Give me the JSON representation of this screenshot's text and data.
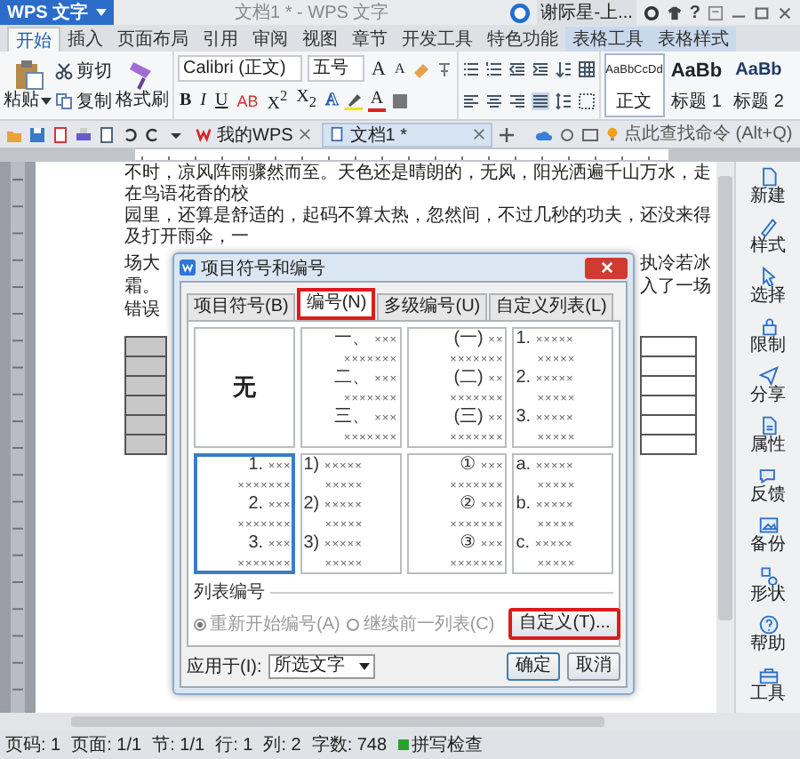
{
  "app_button": {
    "label": "WPS 文字"
  },
  "window": {
    "title": "文档1 * - WPS 文字",
    "user": "谢际星-上...",
    "help": "?"
  },
  "ribbon_tabs": [
    {
      "label": "开始",
      "selected": true,
      "kind": "main"
    },
    {
      "label": "插入",
      "selected": false,
      "kind": "main"
    },
    {
      "label": "页面布局",
      "selected": false,
      "kind": "main"
    },
    {
      "label": "引用",
      "selected": false,
      "kind": "main"
    },
    {
      "label": "审阅",
      "selected": false,
      "kind": "main"
    },
    {
      "label": "视图",
      "selected": false,
      "kind": "main"
    },
    {
      "label": "章节",
      "selected": false,
      "kind": "main"
    },
    {
      "label": "开发工具",
      "selected": false,
      "kind": "main"
    },
    {
      "label": "特色功能",
      "selected": false,
      "kind": "main"
    },
    {
      "label": "表格工具",
      "selected": false,
      "kind": "context"
    },
    {
      "label": "表格样式",
      "selected": false,
      "kind": "context"
    }
  ],
  "clipboard": {
    "paste": "粘贴",
    "cut": "剪切",
    "copy": "复制",
    "format_painter": "格式刷"
  },
  "font": {
    "family": "Calibri (正文)",
    "size": "五号",
    "grow": "A",
    "shrink": "A",
    "format_buttons": [
      {
        "label": "B",
        "kind": "bold"
      },
      {
        "label": "I",
        "kind": "italic"
      },
      {
        "label": "U",
        "kind": "underline"
      },
      {
        "label": "AB",
        "kind": "strike"
      },
      {
        "label": "X$^{2}$",
        "kind": "plain"
      },
      {
        "label": "X$_{2}$",
        "kind": "plain"
      },
      {
        "label": "A",
        "kind": "effect"
      },
      {
        "label": "A",
        "kind": "color"
      }
    ]
  },
  "styles": [
    {
      "sample": "AaBbCcDd",
      "name": "正文",
      "selected": true,
      "kind": "body"
    },
    {
      "sample": "AaBb",
      "name": "标题 1",
      "selected": false,
      "kind": "heading1"
    },
    {
      "sample": "AaBb",
      "name": "标题 2",
      "selected": false,
      "kind": "heading2"
    }
  ],
  "doc_tabs": [
    {
      "label": "我的WPS",
      "selected": false,
      "kind": "home"
    },
    {
      "label": "文档1 *",
      "selected": true,
      "kind": "doc"
    }
  ],
  "command_search": {
    "placeholder": "点此查找命令 (Alt+Q)"
  },
  "document": {
    "top_lines": [
      "不时，凉风阵雨骤然而至。天色还是晴朗的，无风，阳光洒遍千山万水，走在鸟语花香的校",
      "园里，还算是舒适的，起码不算太热，忽然间，不过几秒的功夫，还没来得及打开雨伞，一"
    ],
    "side_lines": [
      {
        "left": "场大",
        "right": "执冷若冰"
      },
      {
        "left": "霜。",
        "right": "入了一场"
      },
      {
        "left": "错误"
      }
    ],
    "table_rows": [
      {
        "selected": true
      },
      {
        "selected": true
      },
      {
        "selected": true
      },
      {
        "selected": true
      },
      {
        "selected": true
      },
      {
        "selected": true
      }
    ]
  },
  "dialog": {
    "title": "项目符号和编号",
    "tabs": [
      {
        "label": "项目符号(B)",
        "selected": false,
        "highlighted": false
      },
      {
        "label": "编号(N)",
        "selected": true,
        "highlighted": true
      },
      {
        "label": "多级编号(U)",
        "selected": false,
        "highlighted": false
      },
      {
        "label": "自定义列表(L)",
        "selected": false,
        "highlighted": false
      }
    ],
    "previews": [
      {
        "kind": "none",
        "selected": false,
        "rows": [
          {
            "marker": "无"
          }
        ]
      },
      {
        "kind": "centered",
        "selected": false,
        "rows": [
          {
            "marker": "一、",
            "text": "×××"
          },
          {
            "text": "×××××××"
          },
          {
            "marker": "二、",
            "text": "×××"
          },
          {
            "text": "×××××××"
          },
          {
            "marker": "三、",
            "text": "×××"
          },
          {
            "text": "×××××××"
          }
        ]
      },
      {
        "kind": "centered",
        "selected": false,
        "rows": [
          {
            "marker": "(一)",
            "text": "××"
          },
          {
            "text": "×××××××"
          },
          {
            "marker": "(二)",
            "text": "××"
          },
          {
            "text": "×××××××"
          },
          {
            "marker": "(三)",
            "text": "××"
          },
          {
            "text": "×××××××"
          }
        ]
      },
      {
        "kind": "left",
        "selected": false,
        "rows": [
          {
            "marker": "1.",
            "text": "×××××"
          },
          {
            "text": "×××××"
          },
          {
            "marker": "2.",
            "text": "×××××"
          },
          {
            "text": "×××××"
          },
          {
            "marker": "3.",
            "text": "×××××"
          },
          {
            "text": "×××××"
          }
        ]
      },
      {
        "kind": "centered",
        "selected": true,
        "rows": [
          {
            "marker": "1.",
            "text": "×××"
          },
          {
            "text": "×××××××"
          },
          {
            "marker": "2.",
            "text": "×××"
          },
          {
            "text": "×××××××"
          },
          {
            "marker": "3.",
            "text": "×××"
          },
          {
            "text": "×××××××"
          }
        ]
      },
      {
        "kind": "left",
        "selected": false,
        "rows": [
          {
            "marker": "1)",
            "text": "×××××"
          },
          {
            "text": "×××××"
          },
          {
            "marker": "2)",
            "text": "×××××"
          },
          {
            "text": "×××××"
          },
          {
            "marker": "3)",
            "text": "×××××"
          },
          {
            "text": "×××××"
          }
        ]
      },
      {
        "kind": "centered",
        "selected": false,
        "rows": [
          {
            "marker": "①",
            "text": "×××"
          },
          {
            "text": "×××××××"
          },
          {
            "marker": "②",
            "text": "×××"
          },
          {
            "text": "×××××××"
          },
          {
            "marker": "③",
            "text": "×××"
          },
          {
            "text": "×××××××"
          }
        ]
      },
      {
        "kind": "left",
        "selected": false,
        "rows": [
          {
            "marker": "a.",
            "text": "×××××"
          },
          {
            "text": "×××××"
          },
          {
            "marker": "b.",
            "text": "×××××"
          },
          {
            "text": "×××××"
          },
          {
            "marker": "c.",
            "text": "×××××"
          },
          {
            "text": "×××××"
          }
        ]
      }
    ],
    "list_label": "列表编号",
    "radios": [
      {
        "label": "重新开始编号(A)",
        "checked": true,
        "disabled": true
      },
      {
        "label": "继续前一列表(C)",
        "checked": false,
        "disabled": true
      }
    ],
    "customize": {
      "label": "自定义(T)...",
      "highlighted": true
    },
    "apply_label": "应用于(I):",
    "apply_value": "所选文字",
    "ok": "确定",
    "cancel": "取消"
  },
  "sidebar": [
    {
      "label": "新建"
    },
    {
      "label": "样式"
    },
    {
      "label": "选择"
    },
    {
      "label": "限制"
    },
    {
      "label": "分享"
    },
    {
      "label": "属性"
    },
    {
      "label": "反馈"
    },
    {
      "label": "备份"
    },
    {
      "label": "形状"
    },
    {
      "label": "帮助"
    },
    {
      "label": "工具"
    }
  ],
  "status_bar": [
    "页码: 1",
    "页面: 1/1",
    "节: 1/1",
    "行: 1",
    "列: 2",
    "字数: 748"
  ],
  "spell_check": {
    "label": "拼写检查",
    "on": true
  }
}
